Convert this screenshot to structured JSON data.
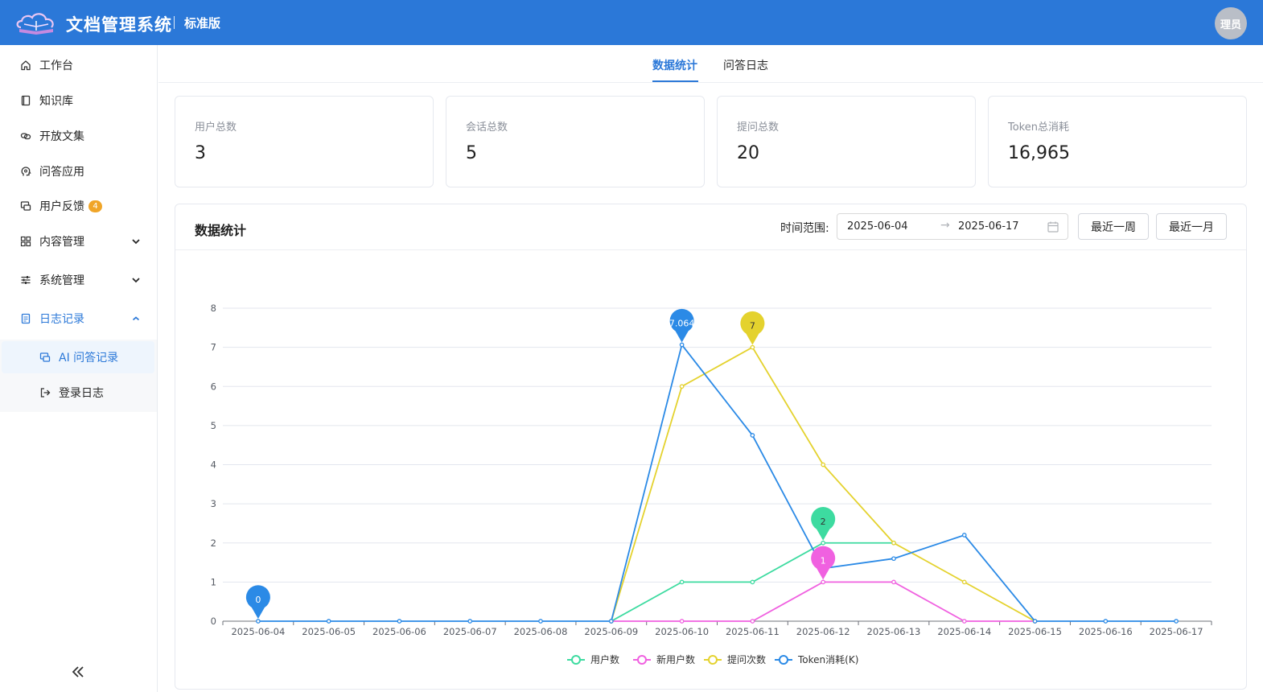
{
  "header": {
    "title": "文档管理系统",
    "edition": "标准版",
    "avatar_text": "理员",
    "color": "#2b78d8"
  },
  "sidebar": {
    "items": [
      {
        "label": "工作台",
        "icon": "home-icon"
      },
      {
        "label": "知识库",
        "icon": "book-icon"
      },
      {
        "label": "开放文集",
        "icon": "link-icon"
      },
      {
        "label": "问答应用",
        "icon": "brain-icon"
      },
      {
        "label": "用户反馈",
        "icon": "feedback-icon",
        "badge": "4"
      },
      {
        "label": "内容管理",
        "icon": "grid-icon",
        "expanded": false
      },
      {
        "label": "系统管理",
        "icon": "sliders-icon",
        "expanded": false
      },
      {
        "label": "日志记录",
        "icon": "log-icon",
        "expanded": true
      }
    ],
    "sub_items": [
      {
        "label": "AI 问答记录",
        "icon": "chat-icon",
        "selected": true
      },
      {
        "label": "登录日志",
        "icon": "login-icon",
        "selected": false
      }
    ],
    "collapse_icon": "double-chevron-left-icon"
  },
  "tabs": [
    {
      "label": "数据统计",
      "active": true
    },
    {
      "label": "问答日志",
      "active": false
    }
  ],
  "stats": [
    {
      "label": "用户总数",
      "value": "3"
    },
    {
      "label": "会话总数",
      "value": "5"
    },
    {
      "label": "提问总数",
      "value": "20"
    },
    {
      "label": "Token总消耗",
      "value": "16,965"
    }
  ],
  "panel": {
    "title": "数据统计",
    "range_label": "时间范围:",
    "start_date": "2025-06-04",
    "end_date": "2025-06-17",
    "range_arrow": "→",
    "btn_week": "最近一周",
    "btn_month": "最近一月"
  },
  "chart_data": {
    "type": "line",
    "categories": [
      "2025-06-04",
      "2025-06-05",
      "2025-06-06",
      "2025-06-07",
      "2025-06-08",
      "2025-06-09",
      "2025-06-10",
      "2025-06-11",
      "2025-06-12",
      "2025-06-13",
      "2025-06-14",
      "2025-06-15",
      "2025-06-16",
      "2025-06-17"
    ],
    "y_ticks": [
      "0",
      "1",
      "2",
      "3",
      "4",
      "5",
      "6",
      "7",
      "8"
    ],
    "ylim": [
      0,
      8
    ],
    "grid": true,
    "legend_position": "bottom",
    "series": [
      {
        "name": "用户数",
        "color": "#3ddba0",
        "values": [
          null,
          null,
          null,
          null,
          null,
          0,
          1,
          1,
          2,
          2,
          null,
          null,
          null,
          null
        ],
        "max_label": "2",
        "max_index": 8
      },
      {
        "name": "新用户数",
        "color": "#f061e0",
        "values": [
          null,
          null,
          null,
          null,
          null,
          0,
          0,
          0,
          1,
          1,
          0,
          0,
          null,
          null
        ],
        "max_label": "1",
        "max_index": 8
      },
      {
        "name": "提问次数",
        "color": "#e4d22e",
        "values": [
          null,
          null,
          null,
          null,
          null,
          0,
          6,
          7,
          4,
          2,
          1,
          0,
          null,
          null
        ],
        "max_label": "7",
        "max_index": 7
      },
      {
        "name": "Token消耗(K)",
        "color": "#2b8ae6",
        "values": [
          0,
          0,
          0,
          0,
          0,
          0,
          7.064,
          4.75,
          1.35,
          1.6,
          2.2,
          0,
          0,
          0
        ],
        "max_label": "7.064",
        "max_index": 6,
        "min_label": "0",
        "min_index": 0
      }
    ]
  }
}
